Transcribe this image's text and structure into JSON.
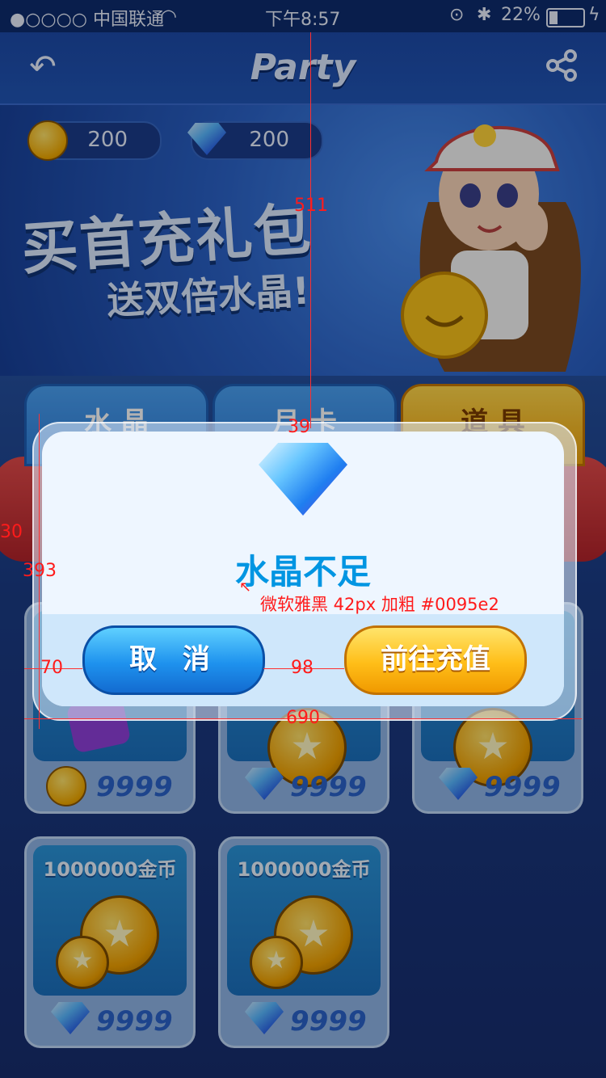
{
  "status_bar": {
    "carrier": "●○○○○ 中国联通",
    "time": "下午8:57",
    "battery": "22%"
  },
  "header": {
    "title": "Party",
    "back_icon": "undo-arrow-icon",
    "share_icon": "share-icon"
  },
  "wallet": {
    "coins": "200",
    "crystals": "200"
  },
  "banner": {
    "line1": "买首充礼包",
    "line2": "送双倍水晶!"
  },
  "tabs": [
    {
      "label": "水 晶"
    },
    {
      "label": "月 卡"
    },
    {
      "label": "道 具"
    }
  ],
  "products": [
    {
      "name": "",
      "price": "9999",
      "currency": "coin"
    },
    {
      "name": "",
      "price": "9999",
      "currency": "crystal"
    },
    {
      "name": "",
      "price": "9999",
      "currency": "crystal"
    },
    {
      "name": "1000000金币",
      "price": "9999",
      "currency": "crystal"
    },
    {
      "name": "1000000金币",
      "price": "9999",
      "currency": "crystal"
    }
  ],
  "dialog": {
    "title": "水晶不足",
    "cancel_label": "取 消",
    "recharge_label": "前往充值"
  },
  "annotations": {
    "a511": "511",
    "a39": "39",
    "a30": "30",
    "a393": "393",
    "a70": "70",
    "a98": "98",
    "a690": "690",
    "font_note": "微软雅黑 42px 加粗 #0095e2"
  },
  "colors": {
    "dialog_title": "#0095e2",
    "annotation": "#ff1b1b"
  }
}
